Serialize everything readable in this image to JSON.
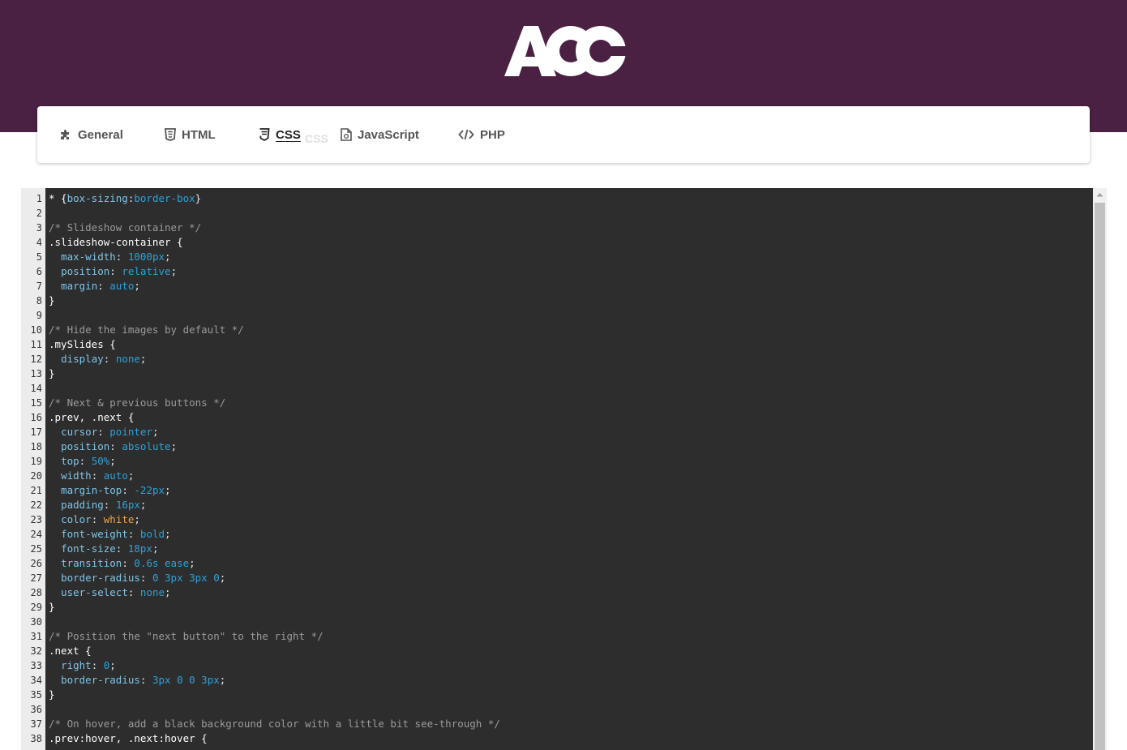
{
  "brand": {
    "logo_text": "ACC",
    "header_color": "#4a2142"
  },
  "tabs": [
    {
      "label": "General",
      "icon": "puzzle-icon"
    },
    {
      "label": "HTML",
      "icon": "html5-icon"
    },
    {
      "label": "CSS",
      "icon": "css3-icon",
      "active": true
    },
    {
      "label": "JavaScript",
      "icon": "js-file-icon"
    },
    {
      "label": "PHP",
      "icon": "code-icon"
    }
  ],
  "ghost_label": "CSS",
  "editor": {
    "language": "css",
    "lines": [
      [
        [
          "sel",
          "* {"
        ],
        [
          "prop",
          "box-sizing"
        ],
        [
          "pun",
          ":"
        ],
        [
          "val",
          "border-box"
        ],
        [
          "pun",
          "}"
        ]
      ],
      [],
      [
        [
          "com",
          "/* Slideshow container */"
        ]
      ],
      [
        [
          "sel",
          ".slideshow-container {"
        ]
      ],
      [
        [
          "sp",
          "  "
        ],
        [
          "prop",
          "max-width"
        ],
        [
          "pun",
          ": "
        ],
        [
          "num",
          "1000px"
        ],
        [
          "pun",
          ";"
        ]
      ],
      [
        [
          "sp",
          "  "
        ],
        [
          "prop",
          "position"
        ],
        [
          "pun",
          ": "
        ],
        [
          "val",
          "relative"
        ],
        [
          "pun",
          ";"
        ]
      ],
      [
        [
          "sp",
          "  "
        ],
        [
          "prop",
          "margin"
        ],
        [
          "pun",
          ": "
        ],
        [
          "val",
          "auto"
        ],
        [
          "pun",
          ";"
        ]
      ],
      [
        [
          "sel",
          "}"
        ]
      ],
      [],
      [
        [
          "com",
          "/* Hide the images by default */"
        ]
      ],
      [
        [
          "sel",
          ".mySlides {"
        ]
      ],
      [
        [
          "sp",
          "  "
        ],
        [
          "prop",
          "display"
        ],
        [
          "pun",
          ": "
        ],
        [
          "val",
          "none"
        ],
        [
          "pun",
          ";"
        ]
      ],
      [
        [
          "sel",
          "}"
        ]
      ],
      [],
      [
        [
          "com",
          "/* Next & previous buttons */"
        ]
      ],
      [
        [
          "sel",
          ".prev, .next {"
        ]
      ],
      [
        [
          "sp",
          "  "
        ],
        [
          "prop",
          "cursor"
        ],
        [
          "pun",
          ": "
        ],
        [
          "val",
          "pointer"
        ],
        [
          "pun",
          ";"
        ]
      ],
      [
        [
          "sp",
          "  "
        ],
        [
          "prop",
          "position"
        ],
        [
          "pun",
          ": "
        ],
        [
          "val",
          "absolute"
        ],
        [
          "pun",
          ";"
        ]
      ],
      [
        [
          "sp",
          "  "
        ],
        [
          "prop",
          "top"
        ],
        [
          "pun",
          ": "
        ],
        [
          "num",
          "50%"
        ],
        [
          "pun",
          ";"
        ]
      ],
      [
        [
          "sp",
          "  "
        ],
        [
          "prop",
          "width"
        ],
        [
          "pun",
          ": "
        ],
        [
          "val",
          "auto"
        ],
        [
          "pun",
          ";"
        ]
      ],
      [
        [
          "sp",
          "  "
        ],
        [
          "prop",
          "margin-top"
        ],
        [
          "pun",
          ": "
        ],
        [
          "num",
          "-22px"
        ],
        [
          "pun",
          ";"
        ]
      ],
      [
        [
          "sp",
          "  "
        ],
        [
          "prop",
          "padding"
        ],
        [
          "pun",
          ": "
        ],
        [
          "num",
          "16px"
        ],
        [
          "pun",
          ";"
        ]
      ],
      [
        [
          "sp",
          "  "
        ],
        [
          "prop",
          "color"
        ],
        [
          "pun",
          ": "
        ],
        [
          "str",
          "white"
        ],
        [
          "pun",
          ";"
        ]
      ],
      [
        [
          "sp",
          "  "
        ],
        [
          "prop",
          "font-weight"
        ],
        [
          "pun",
          ": "
        ],
        [
          "val",
          "bold"
        ],
        [
          "pun",
          ";"
        ]
      ],
      [
        [
          "sp",
          "  "
        ],
        [
          "prop",
          "font-size"
        ],
        [
          "pun",
          ": "
        ],
        [
          "num",
          "18px"
        ],
        [
          "pun",
          ";"
        ]
      ],
      [
        [
          "sp",
          "  "
        ],
        [
          "prop",
          "transition"
        ],
        [
          "pun",
          ": "
        ],
        [
          "num",
          "0.6s"
        ],
        [
          "pun",
          " "
        ],
        [
          "val",
          "ease"
        ],
        [
          "pun",
          ";"
        ]
      ],
      [
        [
          "sp",
          "  "
        ],
        [
          "prop",
          "border-radius"
        ],
        [
          "pun",
          ": "
        ],
        [
          "num",
          "0 3px 3px 0"
        ],
        [
          "pun",
          ";"
        ]
      ],
      [
        [
          "sp",
          "  "
        ],
        [
          "prop",
          "user-select"
        ],
        [
          "pun",
          ": "
        ],
        [
          "val",
          "none"
        ],
        [
          "pun",
          ";"
        ]
      ],
      [
        [
          "sel",
          "}"
        ]
      ],
      [],
      [
        [
          "com",
          "/* Position the \"next button\" to the right */"
        ]
      ],
      [
        [
          "sel",
          ".next {"
        ]
      ],
      [
        [
          "sp",
          "  "
        ],
        [
          "prop",
          "right"
        ],
        [
          "pun",
          ": "
        ],
        [
          "num",
          "0"
        ],
        [
          "pun",
          ";"
        ]
      ],
      [
        [
          "sp",
          "  "
        ],
        [
          "prop",
          "border-radius"
        ],
        [
          "pun",
          ": "
        ],
        [
          "num",
          "3px 0 0 3px"
        ],
        [
          "pun",
          ";"
        ]
      ],
      [
        [
          "sel",
          "}"
        ]
      ],
      [],
      [
        [
          "com",
          "/* On hover, add a black background color with a little bit see-through */"
        ]
      ],
      [
        [
          "sel",
          ".prev:hover, .next:hover {"
        ]
      ]
    ]
  }
}
